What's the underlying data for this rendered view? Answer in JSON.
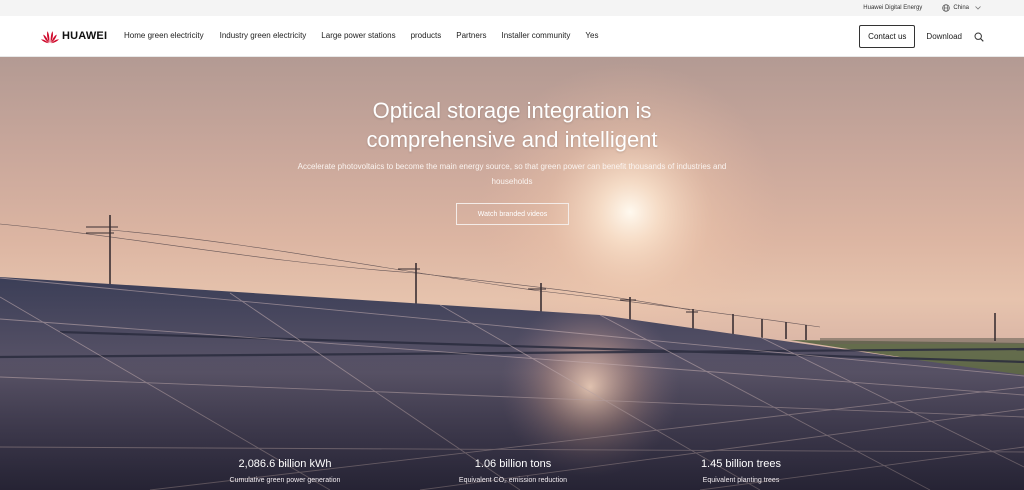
{
  "utility_bar": {
    "link_label": "Huawei Digital Energy",
    "region_label": "China"
  },
  "nav": {
    "logo_text": "HUAWEI",
    "menu": [
      "Home green electricity",
      "Industry green electricity",
      "Large power stations",
      "products",
      "Partners",
      "Installer community",
      "Yes"
    ],
    "contact_label": "Contact us",
    "download_label": "Download",
    "brand_color": "#cf0a2c"
  },
  "hero": {
    "title_line1": "Optical storage integration is",
    "title_line2": "comprehensive and intelligent",
    "subtitle": "Accelerate photovoltaics to become the main energy source, so that green power can benefit thousands of industries and households",
    "button_label": "Watch branded videos"
  },
  "stats": [
    {
      "value": "2,086.6 billion kWh",
      "label": "Cumulative green power generation"
    },
    {
      "value": "1.06 billion tons",
      "label": "Equivalent CO₂ emission reduction"
    },
    {
      "value": "1.45 billion trees",
      "label": "Equivalent planting trees"
    }
  ]
}
